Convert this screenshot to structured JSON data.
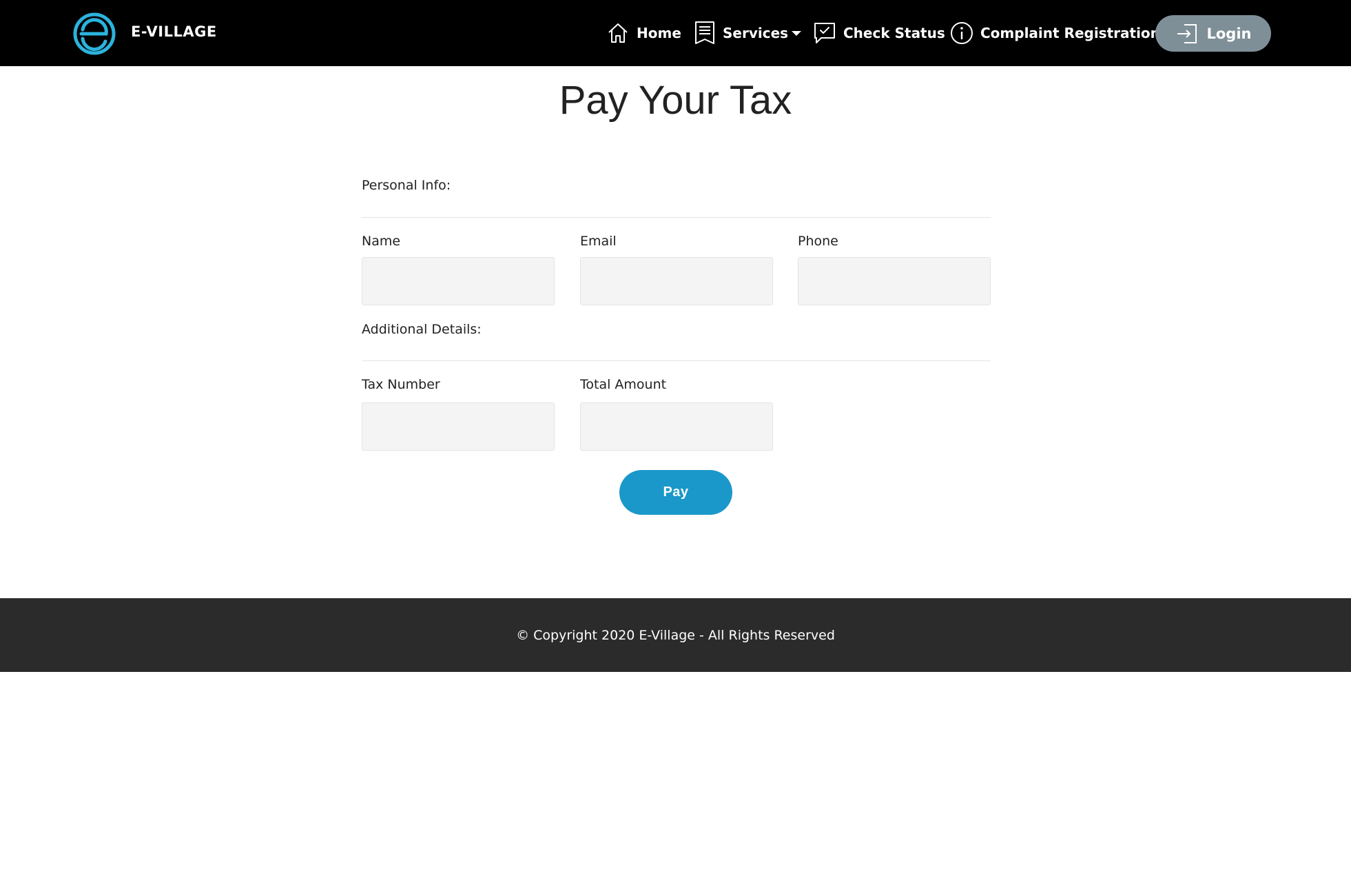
{
  "header": {
    "brand": "E-VILLAGE",
    "logo_icon": "e-village-logo",
    "nav": {
      "home": "Home",
      "services": "Services",
      "check_status": "Check Status",
      "complaint": "Complaint Registration"
    },
    "login_label": "Login"
  },
  "page": {
    "title": "Pay Your Tax"
  },
  "form": {
    "personal_heading": "Personal Info:",
    "name_label": "Name",
    "name_value": "",
    "email_label": "Email",
    "email_value": "",
    "phone_label": "Phone",
    "phone_value": "",
    "additional_heading": "Additional Details:",
    "tax_number_label": "Tax Number",
    "tax_number_value": "",
    "total_amount_label": "Total Amount",
    "total_amount_value": "",
    "pay_label": "Pay"
  },
  "footer": {
    "copyright": "© Copyright 2020 E-Village - All Rights Reserved"
  },
  "colors": {
    "header_bg": "#000000",
    "accent": "#1a98c9",
    "login_bg": "#7f8f98",
    "footer_bg": "#2b2b2b",
    "input_bg": "#f4f4f4"
  }
}
